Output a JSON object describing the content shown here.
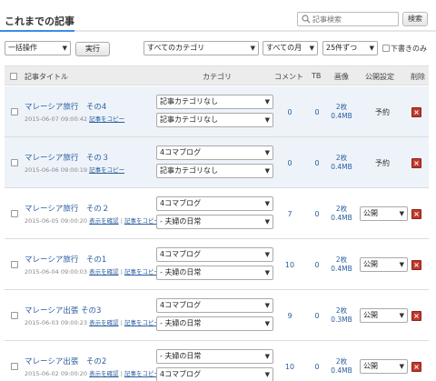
{
  "header": {
    "title": "これまでの記事",
    "search_placeholder": "記事検索",
    "search_button": "検索"
  },
  "toolbar": {
    "bulk_action": "一括操作",
    "execute_button": "実行",
    "category_filter": "すべてのカテゴリ",
    "month_filter": "すべての月",
    "per_page": "25件ずつ",
    "drafts_label": "下書きのみ"
  },
  "table": {
    "headers": {
      "title": "記事タイトル",
      "category": "カテゴリ",
      "comments": "コメント",
      "tb": "TB",
      "images": "画像",
      "status": "公開設定",
      "delete": "削除"
    }
  },
  "rows": [
    {
      "title": "マレーシア旅行　その4",
      "date": "2015-06-07 09:00:42",
      "view_link": "",
      "copy_link": "記事をコピー",
      "category1": "記事カテゴリなし",
      "category2": "記事カテゴリなし",
      "comments": "0",
      "tb": "0",
      "image_count": "2枚",
      "image_size": "0.4MB",
      "status": "予約",
      "type": "scheduled"
    },
    {
      "title": "マレーシア旅行　その３",
      "date": "2015-06-06 09:00:19",
      "view_link": "",
      "copy_link": "記事をコピー",
      "category1": "4コマブログ",
      "category2": "記事カテゴリなし",
      "comments": "0",
      "tb": "0",
      "image_count": "2枚",
      "image_size": "0.4MB",
      "status": "予約",
      "type": "scheduled"
    },
    {
      "title": "マレーシア旅行　その２",
      "date": "2015-06-05 09:00:20",
      "view_link": "表示を確認",
      "copy_link": "記事をコピー",
      "category1": "4コマブログ",
      "category2": "- 夫婦の日常",
      "comments": "7",
      "tb": "0",
      "image_count": "2枚",
      "image_size": "0.4MB",
      "status": "公開",
      "type": "published"
    },
    {
      "title": "マレーシア旅行　その1",
      "date": "2015-06-04 09:00:03",
      "view_link": "表示を確認",
      "copy_link": "記事をコピー",
      "category1": "4コマブログ",
      "category2": "- 夫婦の日常",
      "comments": "10",
      "tb": "0",
      "image_count": "2枚",
      "image_size": "0.4MB",
      "status": "公開",
      "type": "published"
    },
    {
      "title": "マレーシア出張 その3",
      "date": "2015-06-03 09:00:23",
      "view_link": "表示を確認",
      "copy_link": "記事をコピー",
      "category1": "4コマブログ",
      "category2": "- 夫婦の日常",
      "comments": "9",
      "tb": "0",
      "image_count": "2枚",
      "image_size": "0.3MB",
      "status": "公開",
      "type": "published"
    },
    {
      "title": "マレーシア出張　その2",
      "date": "2015-06-02 09:00:20",
      "view_link": "表示を確認",
      "copy_link": "記事をコピー",
      "category1": "- 夫婦の日常",
      "category2": "4コマブログ",
      "comments": "10",
      "tb": "0",
      "image_count": "2枚",
      "image_size": "0.4MB",
      "status": "公開",
      "type": "published"
    }
  ],
  "colors": {
    "accent": "#3a8ee6",
    "link": "#2a5d9f",
    "scheduled_row_bg": "#eef3fa",
    "delete": "#c0392b"
  },
  "icons": {
    "search": "search-icon",
    "delete": "delete-x-icon",
    "dropdown": "chevron-down-icon"
  }
}
